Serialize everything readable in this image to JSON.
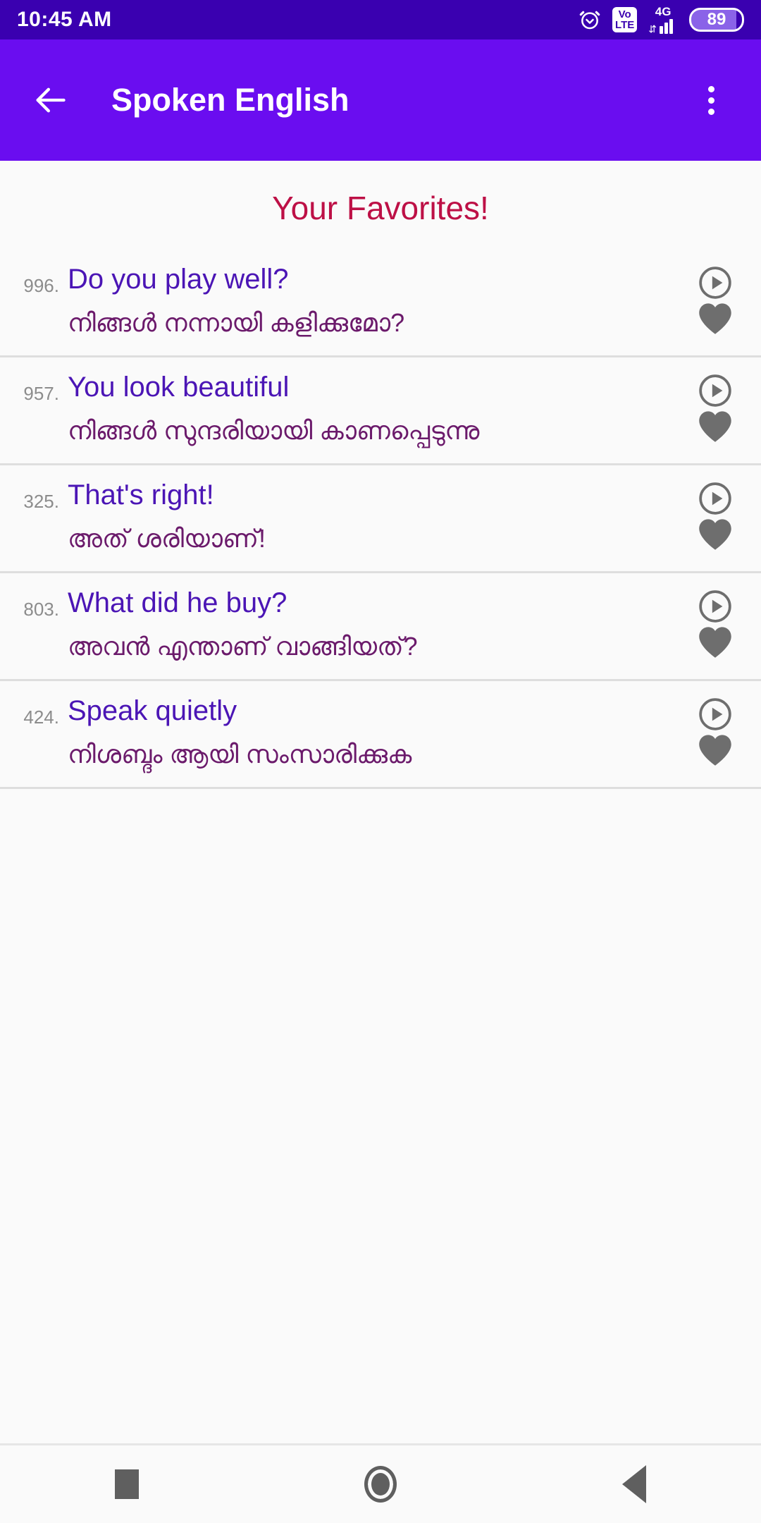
{
  "status_bar": {
    "time": "10:45 AM",
    "alarm_icon": "alarm-clock-icon",
    "volte_top": "Vo",
    "volte_bottom": "LTE",
    "network_type": "4G",
    "data_arrows": "⇵",
    "battery_percent": "89"
  },
  "app_bar": {
    "back_icon": "back-arrow-icon",
    "title": "Spoken English",
    "overflow_icon": "overflow-menu-icon"
  },
  "main": {
    "page_title": "Your Favorites!",
    "items": [
      {
        "number": "996.",
        "english": "Do you play well?",
        "malayalam": "നിങ്ങൾ നന്നായി കളിക്കുമോ?",
        "play_icon": "play-circle-icon",
        "favorite_icon": "heart-filled-icon"
      },
      {
        "number": "957.",
        "english": "You look beautiful",
        "malayalam": "നിങ്ങൾ സുന്ദരിയായി കാണപ്പെടുന്നു",
        "play_icon": "play-circle-icon",
        "favorite_icon": "heart-filled-icon"
      },
      {
        "number": "325.",
        "english": "That's right!",
        "malayalam": "അത് ശരിയാണ്!",
        "play_icon": "play-circle-icon",
        "favorite_icon": "heart-filled-icon"
      },
      {
        "number": "803.",
        "english": "What did he buy?",
        "malayalam": "അവൻ എന്താണ് വാങ്ങിയത്?",
        "play_icon": "play-circle-icon",
        "favorite_icon": "heart-filled-icon"
      },
      {
        "number": "424.",
        "english": "Speak quietly",
        "malayalam": "നിശബ്ദം ആയി സംസാരിക്കുക",
        "play_icon": "play-circle-icon",
        "favorite_icon": "heart-filled-icon"
      }
    ]
  },
  "nav_bar": {
    "recents_icon": "recents-square-icon",
    "home_icon": "home-circle-icon",
    "back_icon": "back-triangle-icon"
  },
  "colors": {
    "status_bar_bg": "#3A00B0",
    "app_bar_bg": "#6A0DF0",
    "page_bg": "#FAFAFA",
    "title_accent": "#BD1046",
    "english_text": "#4B15B5",
    "malayalam_text": "#6B1A6B",
    "number_text": "#8C8C8C",
    "icon_gray": "#6E6E6E",
    "divider": "#DEDEDE"
  }
}
